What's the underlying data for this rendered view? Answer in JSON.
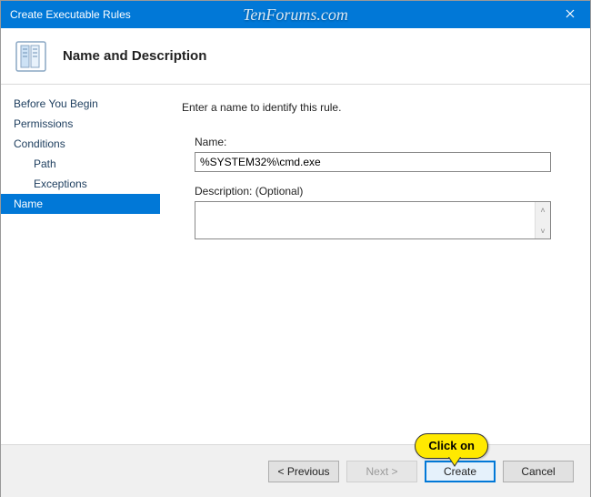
{
  "window": {
    "title": "Create Executable Rules",
    "watermark": "TenForums.com"
  },
  "header": {
    "title": "Name and Description"
  },
  "sidebar": {
    "items": [
      {
        "label": "Before You Begin",
        "indent": false,
        "selected": false
      },
      {
        "label": "Permissions",
        "indent": false,
        "selected": false
      },
      {
        "label": "Conditions",
        "indent": false,
        "selected": false
      },
      {
        "label": "Path",
        "indent": true,
        "selected": false
      },
      {
        "label": "Exceptions",
        "indent": true,
        "selected": false
      },
      {
        "label": "Name",
        "indent": false,
        "selected": true
      }
    ]
  },
  "content": {
    "instruction": "Enter a name to identify this rule.",
    "name_label": "Name:",
    "name_value": "%SYSTEM32%\\cmd.exe",
    "description_label": "Description: (Optional)",
    "description_value": ""
  },
  "footer": {
    "previous": "< Previous",
    "next": "Next >",
    "create": "Create",
    "cancel": "Cancel"
  },
  "annotation": {
    "callout": "Click on"
  }
}
